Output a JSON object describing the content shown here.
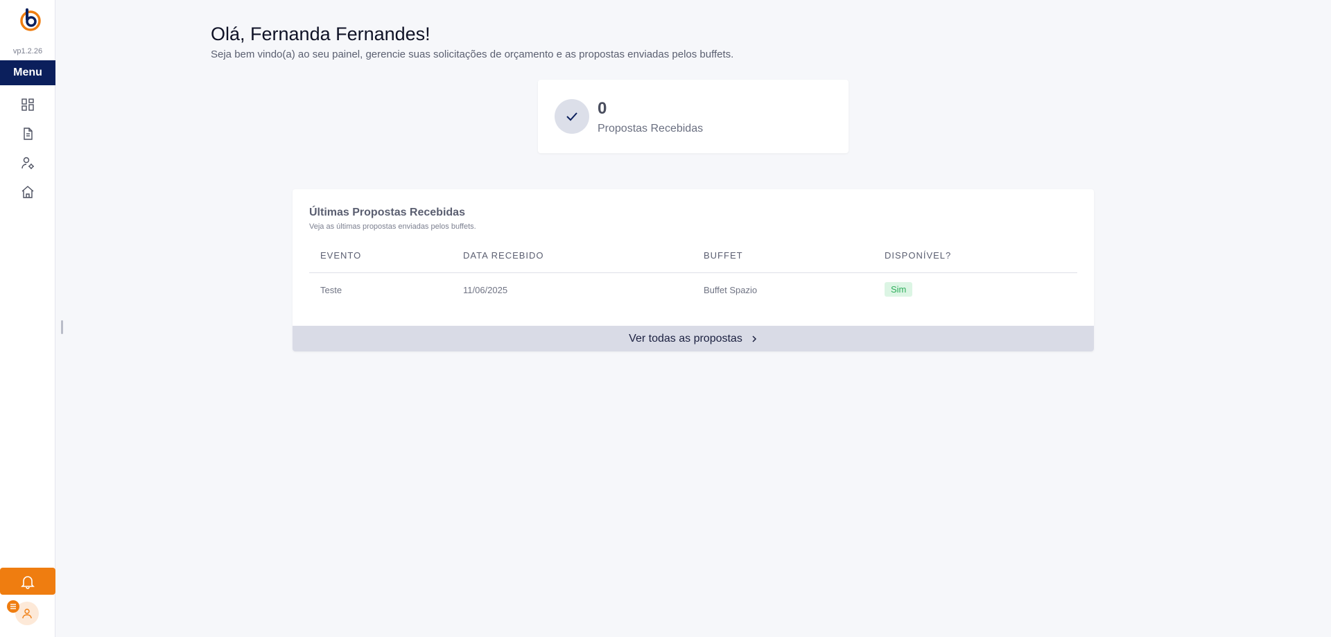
{
  "sidebar": {
    "version": "vp1.2.26",
    "menu_label": "Menu",
    "items": [
      {
        "icon": "dashboard-icon"
      },
      {
        "icon": "document-icon"
      },
      {
        "icon": "user-settings-icon"
      },
      {
        "icon": "home-icon"
      }
    ],
    "accent_color": "#ef7d10",
    "menu_color": "#0b1f5c"
  },
  "header": {
    "greeting": "Olá, Fernanda Fernandes!",
    "subtitle": "Seja bem vindo(a) ao seu painel, gerencie suas solicitações de orçamento e as propostas enviadas pelos buffets."
  },
  "stats": {
    "value": "0",
    "label": "Propostas Recebidas"
  },
  "proposals": {
    "title": "Últimas Propostas Recebidas",
    "subtitle": "Veja as últimas propostas enviadas pelos buffets.",
    "columns": [
      "EVENTO",
      "DATA RECEBIDO",
      "BUFFET",
      "DISPONÍVEL?"
    ],
    "rows": [
      {
        "evento": "Teste",
        "data": "11/06/2025",
        "buffet": "Buffet Spazio",
        "disponivel": "Sim"
      }
    ],
    "see_all_label": "Ver todas as propostas"
  }
}
